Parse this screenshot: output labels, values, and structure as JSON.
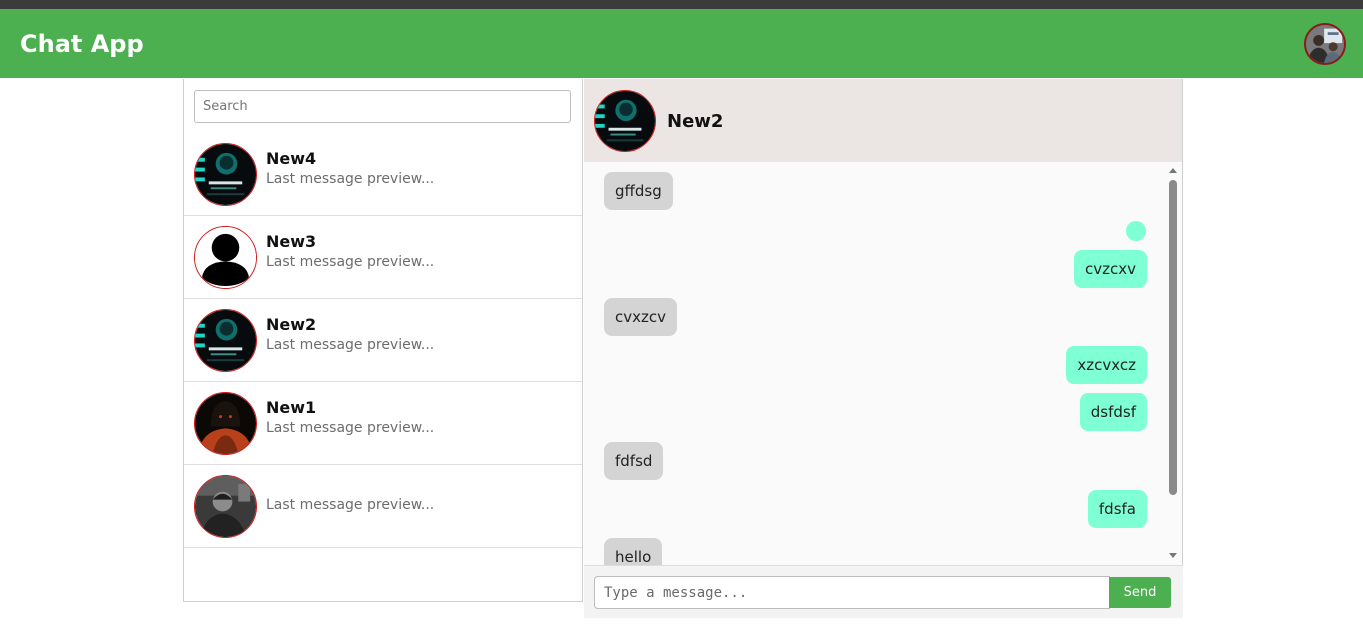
{
  "app": {
    "title": "Chat App"
  },
  "sidebar": {
    "search": {
      "placeholder": "Search",
      "value": ""
    },
    "contacts": [
      {
        "name": "New4",
        "preview": "Last message preview...",
        "avatar": "dark-screenshot-avatar"
      },
      {
        "name": "New3",
        "preview": "Last message preview...",
        "avatar": "default-user-avatar"
      },
      {
        "name": "New2",
        "preview": "Last message preview...",
        "avatar": "dark-screenshot-avatar"
      },
      {
        "name": "New1",
        "preview": "Last message preview...",
        "avatar": "hooded-figure-avatar"
      },
      {
        "name": "",
        "preview": "Last message preview...",
        "avatar": "grayscale-photo-avatar"
      }
    ]
  },
  "chat": {
    "title": "New2",
    "messages": [
      {
        "text": "gffdsg",
        "direction": "in"
      },
      {
        "text": "",
        "direction": "out"
      },
      {
        "text": "cvzcxv",
        "direction": "out"
      },
      {
        "text": "cvxzcv",
        "direction": "in"
      },
      {
        "text": "xzcvxcz",
        "direction": "out"
      },
      {
        "text": "dsfdsf",
        "direction": "out"
      },
      {
        "text": "fdfsd",
        "direction": "in"
      },
      {
        "text": "fdsfa",
        "direction": "out"
      },
      {
        "text": "hello",
        "direction": "in"
      }
    ],
    "composer": {
      "placeholder": "Type a message...",
      "value": "",
      "send_label": "Send"
    }
  },
  "colors": {
    "primary": "#4caf50",
    "outgoing_bubble": "#7fffd4",
    "incoming_bubble": "#d4d4d4",
    "chat_header": "#ebe6e4",
    "avatar_border": "#d11a1a"
  }
}
